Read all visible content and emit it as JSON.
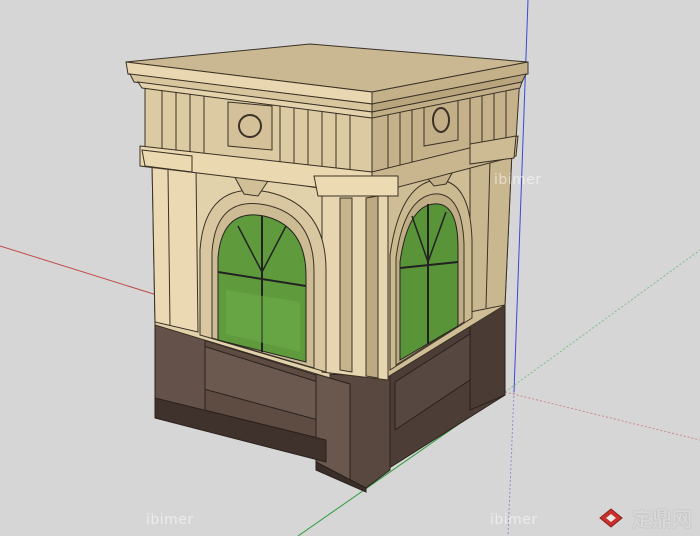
{
  "watermarks": {
    "top_right": "ibimer",
    "bottom_left": "ibimer",
    "bottom_middle": "ibimer"
  },
  "logo": {
    "text": "定鼎网",
    "icon": "diamond-logo-icon"
  },
  "colors": {
    "background": "#d6d6d6",
    "stone": "#ddcca6",
    "stone_shadow": "#b9a782",
    "granite": "#5e4c43",
    "glass": "#5f9b3d",
    "axis_red": "#c14a4a",
    "axis_green": "#2e9b3a",
    "axis_blue": "#3a4bd6"
  }
}
